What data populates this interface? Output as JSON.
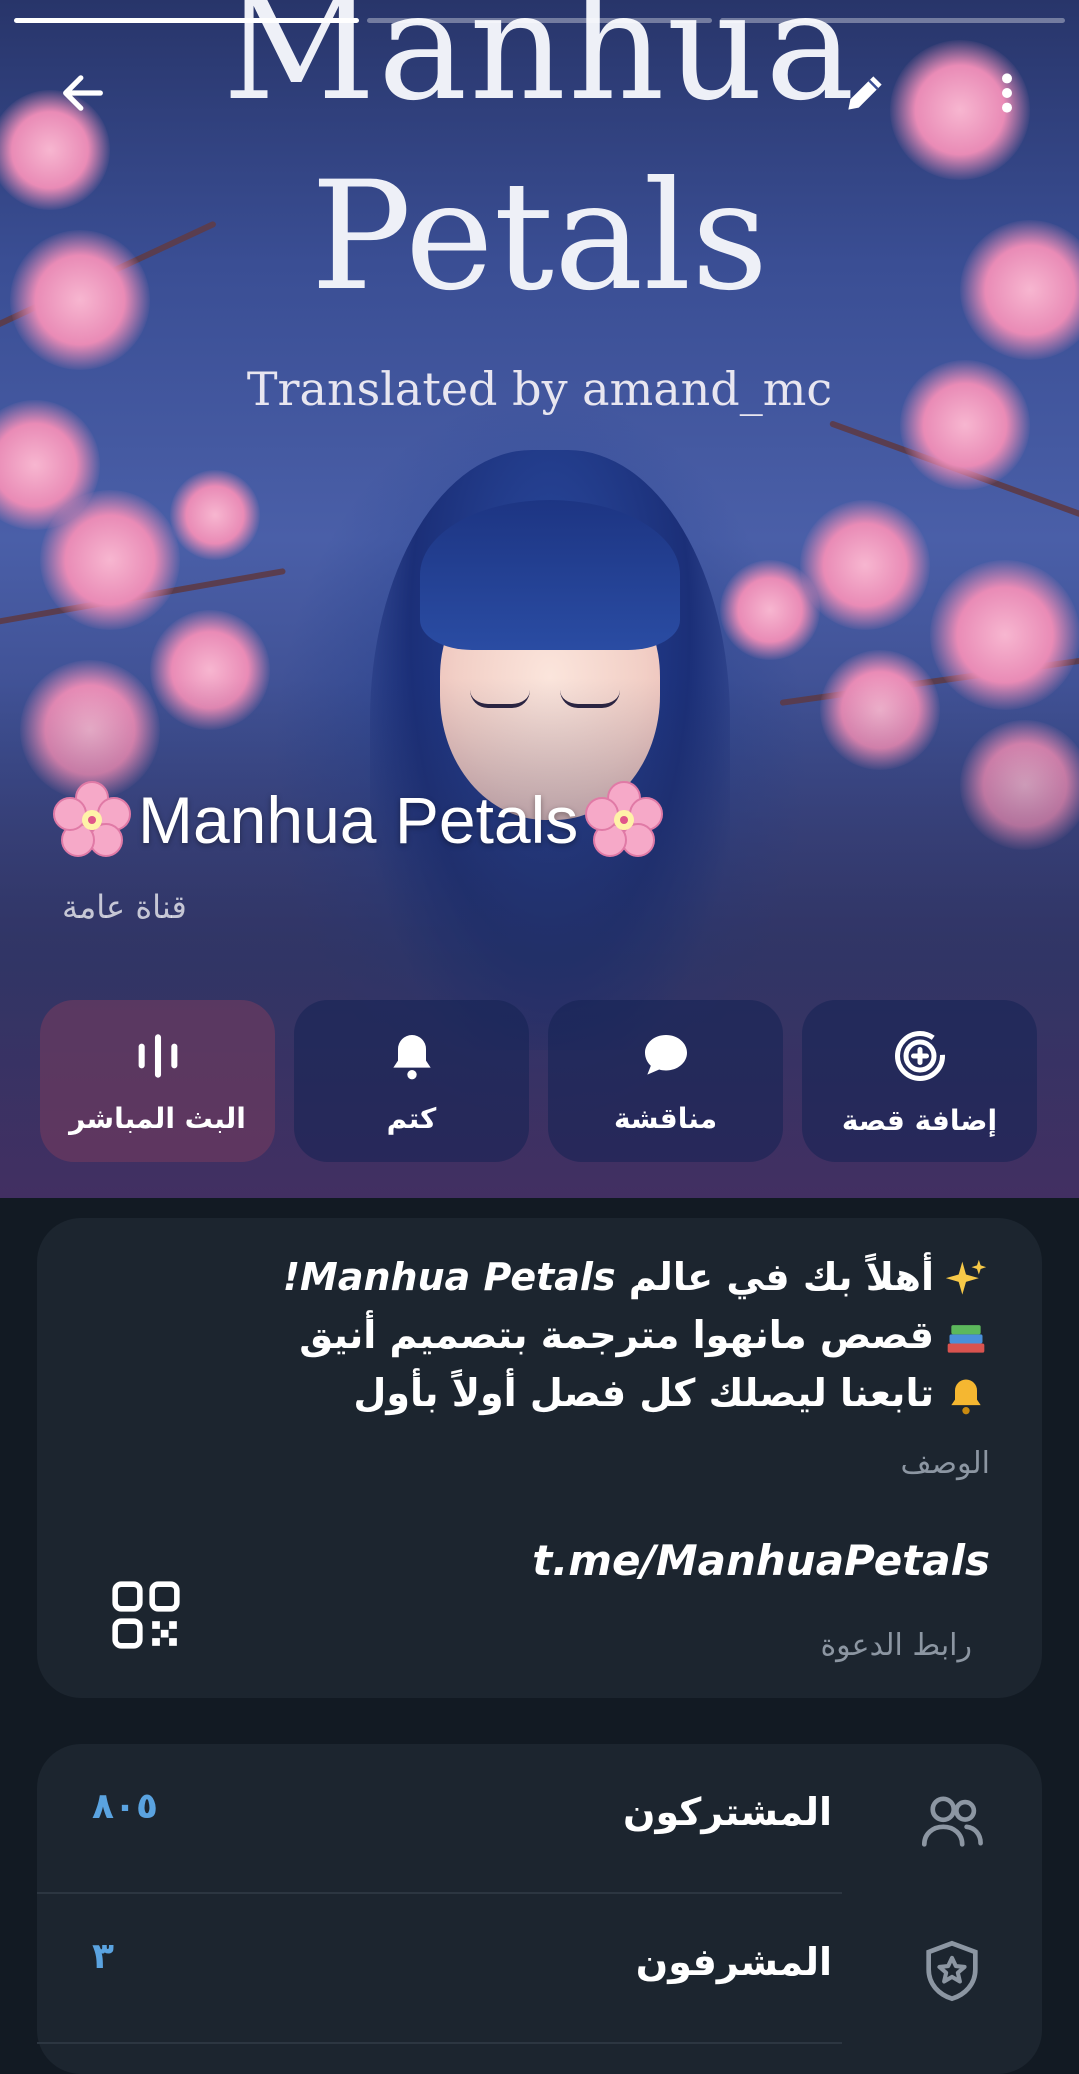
{
  "progress": {
    "segments": 3,
    "active_index": 0
  },
  "cover": {
    "title_line1": "Manhua",
    "title_line2": "Petals",
    "subtitle": "Translated by amand_mc"
  },
  "channel": {
    "name": "Manhua Petals",
    "type": "قناة عامة",
    "name_decoration_icon": "cherry-blossom-emoji"
  },
  "top_bar": {
    "back_icon": "arrow-left-icon",
    "edit_icon": "pencil-icon",
    "more_icon": "more-vertical-icon"
  },
  "actions": [
    {
      "label": "البث المباشر",
      "icon": "live-stream-icon"
    },
    {
      "label": "كتم",
      "icon": "bell-icon"
    },
    {
      "label": "مناقشة",
      "icon": "chat-bubble-icon"
    },
    {
      "label": "إضافة قصة",
      "icon": "add-story-icon"
    }
  ],
  "description": {
    "lines": [
      {
        "emoji": "sparkles-emoji",
        "text_before": "أهلاً بك في عالم ",
        "text_em": "Manhua Petals!"
      },
      {
        "emoji": "books-emoji",
        "text": "قصص مانهوا مترجمة بتصميم أنيق"
      },
      {
        "emoji": "bell-emoji",
        "text": "تابعنا ليصلك كل فصل أولاً بأول"
      }
    ],
    "caption": "الوصف"
  },
  "invite": {
    "link": "t.me/ManhuaPetals",
    "caption": "رابط الدعوة",
    "qr_icon": "qr-code-icon"
  },
  "info_rows": [
    {
      "label": "المشتركون",
      "value": "٨٠٥",
      "icon": "people-icon"
    },
    {
      "label": "المشرفون",
      "value": "٣",
      "icon": "shield-star-icon"
    }
  ],
  "colors": {
    "background": "#121a23",
    "card": "#1c252f",
    "accent_blue": "#5aa3e0",
    "muted_text": "#8c96a2"
  }
}
